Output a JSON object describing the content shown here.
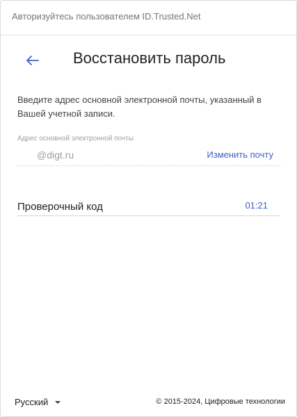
{
  "header": {
    "title": "Авторизуйтесь пользователем ID.Trusted.Net"
  },
  "page": {
    "title": "Восстановить пароль",
    "instruction": "Введите адрес основной электронной почты, указанный в Вашей учетной записи."
  },
  "email": {
    "label": "Адрес основной электронной почты",
    "value": "@digt.ru",
    "change_label": "Изменить почту"
  },
  "code": {
    "label": "Проверочный код",
    "timer": "01:21"
  },
  "footer": {
    "language": "Русский",
    "copyright": "© 2015-2024, Цифровые технологии"
  },
  "colors": {
    "accent": "#3f62c5"
  }
}
